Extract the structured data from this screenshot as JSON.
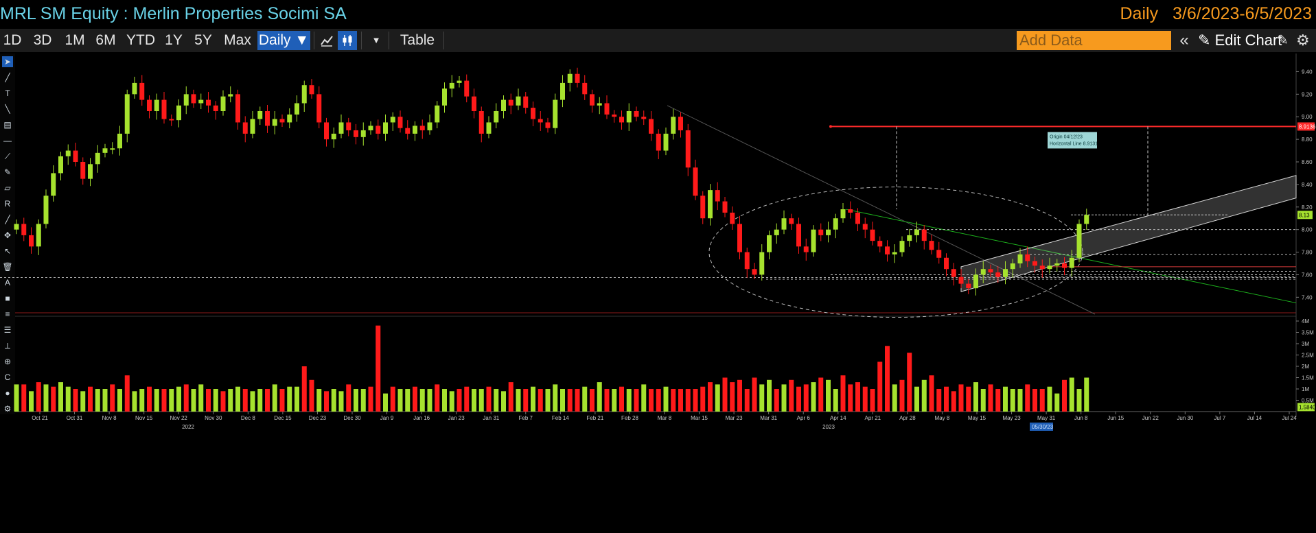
{
  "header": {
    "title": "MRL SM Equity : Merlin Properties Socimi SA",
    "frequency": "Daily",
    "date_range": "3/6/2023-6/5/2023"
  },
  "toolbar": {
    "ranges": [
      "1D",
      "3D",
      "1M",
      "6M",
      "YTD",
      "1Y",
      "5Y",
      "Max"
    ],
    "frequency_button": "Daily ▼",
    "table_label": "Table",
    "add_data_placeholder": "Add Data",
    "edit_chart_label": "Edit Chart",
    "collapse_icon": "double-chevron-left-icon",
    "pencil_icon": "pencil-icon",
    "settings_icon": "gear-icon",
    "line_chart_icon": "line-chart-icon",
    "candle_chart_icon": "candlestick-chart-icon"
  },
  "colors": {
    "up": "#a6e22e",
    "down": "#ff1a1a",
    "horizontal_line": "#ff2a2a",
    "channel": "#d8d8d8",
    "green_trend": "#1db31d",
    "background": "#000000",
    "title": "#69d2e7",
    "period": "#f79a1e"
  },
  "annotations": {
    "tooltip_line1": "Origin 04/12/23",
    "tooltip_line2": "Horizontal Line 8.9131",
    "last_price": "8.13",
    "horizontal_line_value": "8.9136",
    "volume_last": "1.5840",
    "date_marker": "05/30/23"
  },
  "chart_data": {
    "type": "candlestick",
    "price_axis": {
      "ticks": [
        "9.40",
        "9.20",
        "9.00",
        "8.80",
        "8.60",
        "8.40",
        "8.20",
        "8.00",
        "7.80",
        "7.60",
        "7.40"
      ],
      "ylim": [
        7.25,
        9.5
      ]
    },
    "volume_axis": {
      "ticks": [
        "4M",
        "3.5M",
        "3M",
        "2.5M",
        "2M",
        "1.5M",
        "1M",
        "0.5M"
      ],
      "ylim": [
        0,
        4
      ]
    },
    "x_axis": {
      "ticks": [
        "Oct 21",
        "Oct 31",
        "Nov 8",
        "Nov 15",
        "Nov 22",
        "Nov 30",
        "Dec 8",
        "Dec 15",
        "Dec 23",
        "Dec 30",
        "Jan 9",
        "Jan 16",
        "Jan 23",
        "Jan 31",
        "Feb 7",
        "Feb 14",
        "Feb 21",
        "Feb 28",
        "Mar 8",
        "Mar 15",
        "Mar 23",
        "Mar 31",
        "Apr 6",
        "Apr 14",
        "Apr 21",
        "Apr 28",
        "May 8",
        "May 15",
        "May 23",
        "May 31",
        "Jun 8",
        "Jun 15",
        "Jun 22",
        "Jun 30",
        "Jul 7",
        "Jul 14",
        "Jul 24"
      ],
      "years": [
        "2022",
        "2023"
      ]
    },
    "closes": [
      8.05,
      7.95,
      7.85,
      8.05,
      8.3,
      8.5,
      8.65,
      8.7,
      8.6,
      8.45,
      8.58,
      8.68,
      8.72,
      8.72,
      8.85,
      9.2,
      9.3,
      9.15,
      9.05,
      9.15,
      8.98,
      8.97,
      9.1,
      9.2,
      9.12,
      9.15,
      9.1,
      9.05,
      9.18,
      9.2,
      8.95,
      8.85,
      8.98,
      9.05,
      8.92,
      8.98,
      8.95,
      9.02,
      9.12,
      9.28,
      9.2,
      8.95,
      8.8,
      8.85,
      8.95,
      8.88,
      8.82,
      8.88,
      8.92,
      8.85,
      8.95,
      9.0,
      8.9,
      8.85,
      8.92,
      8.88,
      8.95,
      9.1,
      9.25,
      9.3,
      9.32,
      9.18,
      9.05,
      8.85,
      8.95,
      9.05,
      9.15,
      9.1,
      9.18,
      9.08,
      8.98,
      8.95,
      8.9,
      9.15,
      9.3,
      9.38,
      9.3,
      9.2,
      9.1,
      9.12,
      9.02,
      9.0,
      8.95,
      9.05,
      9.0,
      8.98,
      8.85,
      8.7,
      8.85,
      9.0,
      8.88,
      8.55,
      8.3,
      8.1,
      8.35,
      8.25,
      8.15,
      8.05,
      7.8,
      7.65,
      7.6,
      7.8,
      7.95,
      8.0,
      8.1,
      8.05,
      7.85,
      7.8,
      8.0,
      7.95,
      8.0,
      8.1,
      8.18,
      8.15,
      8.05,
      8.0,
      7.9,
      7.85,
      7.78,
      7.8,
      7.9,
      7.95,
      8.0,
      7.9,
      7.82,
      7.75,
      7.65,
      7.58,
      7.52,
      7.48,
      7.6,
      7.65,
      7.62,
      7.58,
      7.65,
      7.7,
      7.78,
      7.72,
      7.68,
      7.65,
      7.68,
      7.7,
      7.66,
      7.75,
      8.05,
      8.13
    ],
    "volumes": [
      1.2,
      1.2,
      0.9,
      1.3,
      1.2,
      1.1,
      1.3,
      1.1,
      1.0,
      0.9,
      1.1,
      1.0,
      1.0,
      1.2,
      1.0,
      1.6,
      0.9,
      1.0,
      1.1,
      1.0,
      1.0,
      1.0,
      1.1,
      1.2,
      1.0,
      1.2,
      1.0,
      1.0,
      0.9,
      1.0,
      1.1,
      1.0,
      0.9,
      1.0,
      1.0,
      1.2,
      1.0,
      1.1,
      1.1,
      2.0,
      1.4,
      1.0,
      0.9,
      1.0,
      0.9,
      1.2,
      1.0,
      1.0,
      1.1,
      3.8,
      0.8,
      1.1,
      1.0,
      1.0,
      1.1,
      1.0,
      1.0,
      1.2,
      1.0,
      0.9,
      1.0,
      1.1,
      1.0,
      1.0,
      1.1,
      1.0,
      0.9,
      1.3,
      1.0,
      1.0,
      1.1,
      1.0,
      1.0,
      1.2,
      1.0,
      1.0,
      1.0,
      1.1,
      1.0,
      1.3,
      1.0,
      1.0,
      1.1,
      1.0,
      1.0,
      1.2,
      1.0,
      1.0,
      1.1,
      1.0,
      1.0,
      1.0,
      1.0,
      1.1,
      1.3,
      1.2,
      1.5,
      1.3,
      1.4,
      1.0,
      1.5,
      1.2,
      1.4,
      1.0,
      1.2,
      1.4,
      1.1,
      1.2,
      1.3,
      1.5,
      1.4,
      1.0,
      1.6,
      1.2,
      1.3,
      1.1,
      1.0,
      2.2,
      2.9,
      1.2,
      1.4,
      2.6,
      1.1,
      1.4,
      1.6,
      1.0,
      1.1,
      0.9,
      1.2,
      1.1,
      1.3,
      1.0,
      1.2,
      1.0,
      1.1,
      1.0,
      1.0,
      1.2,
      1.0,
      1.0,
      1.1,
      0.8,
      1.4,
      1.5,
      1.0,
      1.5
    ],
    "volume_up_flags": [
      1,
      0,
      1,
      0,
      1,
      0,
      1,
      1,
      0,
      1,
      0,
      1,
      1,
      0,
      1,
      0,
      1,
      1,
      0,
      1,
      0,
      1,
      1,
      0,
      1,
      1,
      0,
      1,
      0,
      1,
      1,
      0,
      1,
      1,
      0,
      1,
      0,
      1,
      1,
      0,
      0,
      1,
      0,
      1,
      1,
      0,
      1,
      1,
      0,
      0,
      1,
      0,
      1,
      1,
      0,
      1,
      1,
      0,
      1,
      1,
      0,
      0,
      1,
      1,
      0,
      1,
      1,
      0,
      1,
      0,
      1,
      0,
      1,
      1,
      1,
      0,
      0,
      1,
      0,
      1,
      0,
      1,
      0,
      1,
      0,
      1,
      0,
      0,
      1,
      0,
      0,
      0,
      0,
      0,
      0,
      1,
      0,
      0,
      0,
      0,
      0,
      1,
      1,
      0,
      1,
      0,
      0,
      0,
      1,
      0,
      1,
      1,
      0,
      0,
      0,
      0,
      0,
      0,
      0,
      1,
      0,
      0,
      1,
      1,
      0,
      0,
      0,
      0,
      0,
      0,
      1,
      1,
      0,
      0,
      1,
      1,
      1,
      0,
      0,
      0,
      1,
      1,
      0,
      1,
      1,
      1
    ]
  }
}
